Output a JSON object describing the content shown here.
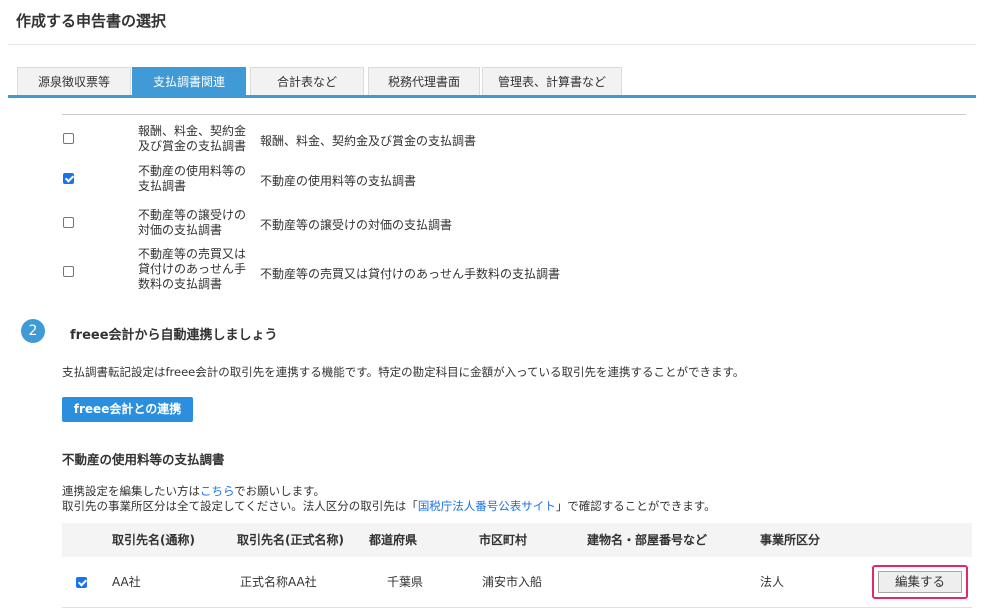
{
  "page_title": "作成する申告書の選択",
  "tabs": [
    {
      "label": "源泉徴収票等",
      "active": false
    },
    {
      "label": "支払調書関連",
      "active": true
    },
    {
      "label": "合計表など",
      "active": false
    },
    {
      "label": "税務代理書面",
      "active": false
    },
    {
      "label": "管理表、計算書など",
      "active": false
    }
  ],
  "forms": [
    {
      "short_name": "報酬、料金、契約金\n及び賞金の支払調書",
      "full_name": "報酬、料金、契約金及び賞金の支払調書",
      "checked": false
    },
    {
      "short_name": "不動産の使用料等の\n支払調書",
      "full_name": "不動産の使用料等の支払調書",
      "checked": true
    },
    {
      "short_name": "不動産等の譲受けの\n対価の支払調書",
      "full_name": "不動産等の譲受けの対価の支払調書",
      "checked": false
    },
    {
      "short_name": "不動産等の売買又は\n貸付けのあっせん手\n数料の支払調書",
      "full_name": "不動産等の売買又は貸付けのあっせん手数料の支払調書",
      "checked": false
    }
  ],
  "step2": {
    "badge": "2",
    "heading": "freee会計から自動連携しましょう",
    "description": "支払調書転記設定はfreee会計の取引先を連携する機能です。特定の勘定科目に金額が入っている取引先を連携することができます。",
    "button_label": "freee会計との連携"
  },
  "subsection": {
    "heading": "不動産の使用料等の支払調書",
    "note1_prefix": "連携設定を編集したい方は",
    "note1_link": "こちら",
    "note1_suffix": "でお願いします。",
    "note2_prefix": "取引先の事業所区分は全て設定してください。法人区分の取引先は「",
    "note2_link": "国税庁法人番号公表サイト",
    "note2_suffix": "」で確認することができます。"
  },
  "table": {
    "headers": [
      "取引先名(通称)",
      "取引先名(正式名称)",
      "都道府県",
      "市区町村",
      "建物名・部屋番号など",
      "事業所区分"
    ],
    "rows": [
      {
        "checked": true,
        "cells": [
          "AA社",
          "正式名称AA社",
          "千葉県",
          "浦安市入船",
          "",
          "法人"
        ],
        "edit_label": "編集する"
      }
    ]
  },
  "colors": {
    "accent": "#3f9ad6",
    "button": "#2b8fde",
    "highlight": "#e3266d"
  }
}
